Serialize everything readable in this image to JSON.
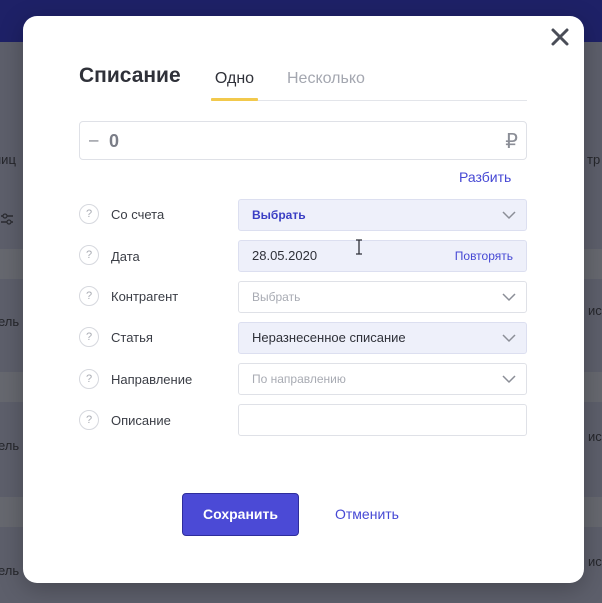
{
  "background": {
    "fragments": [
      "ниц",
      "тр",
      "ель",
      "ис",
      "ель",
      "ис",
      "ель",
      "ис"
    ]
  },
  "dialog": {
    "title": "Списание",
    "tabs": [
      {
        "label": "Одно",
        "active": true
      },
      {
        "label": "Несколько",
        "active": false
      }
    ],
    "amount": {
      "sign": "–",
      "value": "0",
      "currency_symbol": "₽"
    },
    "split_label": "Разбить",
    "fields": [
      {
        "label": "Со счета",
        "value": "Выбрать",
        "has_dropdown": true
      },
      {
        "label": "Дата",
        "value": "28.05.2020",
        "action": "Повторять"
      },
      {
        "label": "Контрагент",
        "placeholder": "Выбрать",
        "has_dropdown": true
      },
      {
        "label": "Статья",
        "value": "Неразнесенное списание",
        "has_dropdown": true
      },
      {
        "label": "Направление",
        "placeholder": "По направлению",
        "has_dropdown": true
      },
      {
        "label": "Описание",
        "value": ""
      }
    ],
    "help_glyph": "?",
    "save_label": "Сохранить",
    "cancel_label": "Отменить"
  },
  "colors": {
    "accent": "#4b4ad6",
    "tab_underline": "#f2c94c",
    "link": "#4648d4",
    "overlay": "#5c5e6a",
    "topbar": "#1e2167"
  },
  "icons": [
    "close-icon",
    "ruble-icon",
    "chevron-down-icon",
    "help-icon",
    "text-cursor-icon"
  ]
}
